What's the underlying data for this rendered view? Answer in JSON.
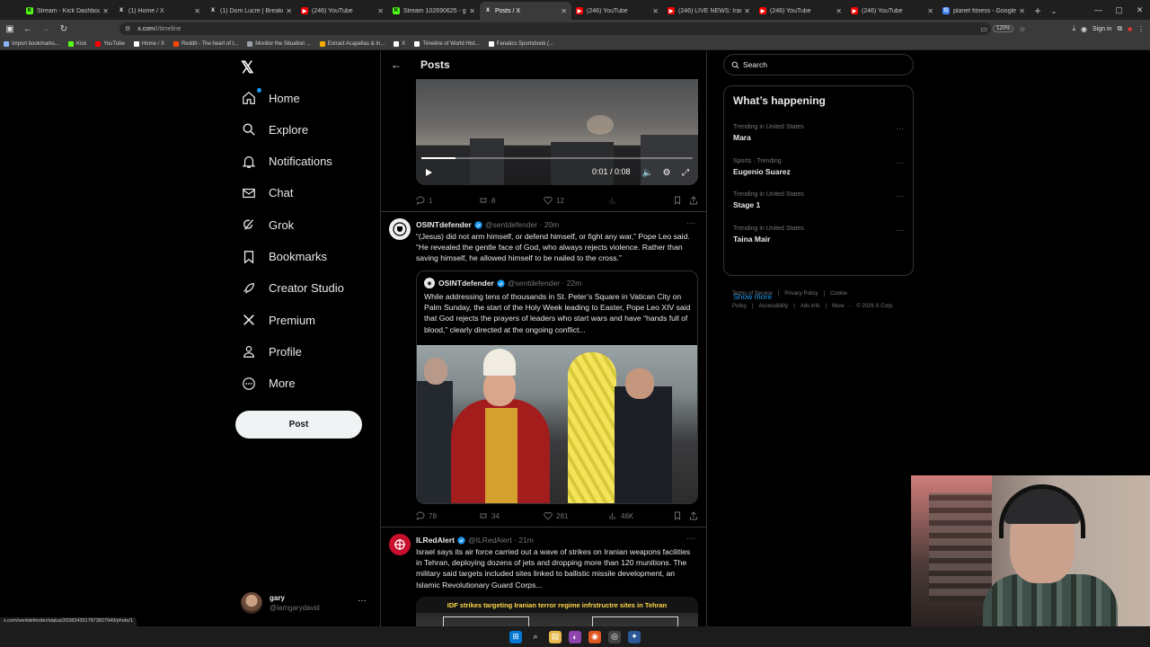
{
  "browser": {
    "tabs": [
      {
        "title": "Stream - Kick Dashboard",
        "fav_color": "#53fc18",
        "fav_glyph": "K",
        "active": false
      },
      {
        "title": "(1) Home / X",
        "fav_color": "#000000",
        "fav_glyph": "X",
        "active": false
      },
      {
        "title": "(1) Dom Lucre | Breaker of I",
        "fav_color": "#000000",
        "fav_glyph": "X",
        "active": false
      },
      {
        "title": "(246) YouTube",
        "fav_color": "#ff0000",
        "fav_glyph": "▶",
        "active": false
      },
      {
        "title": "Stream 102690625 - garyd…",
        "fav_color": "#53fc18",
        "fav_glyph": "K",
        "active": false
      },
      {
        "title": "Posts / X",
        "fav_color": "#000000",
        "fav_glyph": "X",
        "active": true
      },
      {
        "title": "(246) YouTube",
        "fav_color": "#ff0000",
        "fav_glyph": "▶",
        "active": false
      },
      {
        "title": "(246) LIVE NEWS: Iran war I…",
        "fav_color": "#ff0000",
        "fav_glyph": "▶",
        "active": false
      },
      {
        "title": "(246) YouTube",
        "fav_color": "#ff0000",
        "fav_glyph": "▶",
        "active": false
      },
      {
        "title": "(246) YouTube",
        "fav_color": "#ff0000",
        "fav_glyph": "▶",
        "active": false
      },
      {
        "title": "planet fitness - Google Sear…",
        "fav_color": "#4285f4",
        "fav_glyph": "G",
        "active": false
      }
    ],
    "url_host": "x.com",
    "url_path": "/i/timeline",
    "zoom": "120%",
    "signin_label": "Sign in",
    "bookmarks": [
      {
        "label": "Import bookmarks...",
        "color": "#8ab4f8"
      },
      {
        "label": "Kick",
        "color": "#53fc18"
      },
      {
        "label": "YouTube",
        "color": "#ff0000"
      },
      {
        "label": "Home / X",
        "color": "#ffffff"
      },
      {
        "label": "Reddit - The heart of t...",
        "color": "#ff4500"
      },
      {
        "label": "Monitor the Situation ...",
        "color": "#9aa0a6"
      },
      {
        "label": "Extract Acapellas & In...",
        "color": "#f9ab00"
      },
      {
        "label": "X",
        "color": "#ffffff"
      },
      {
        "label": "Timeline of World Hist...",
        "color": "#ffffff"
      },
      {
        "label": "Fanatics Sportsbook (...",
        "color": "#ffffff"
      }
    ],
    "status_url": "x.com/sentdefender/status/2038343517873827949/photo/1"
  },
  "leftnav": {
    "items": [
      {
        "label": "Home",
        "icon": "home-icon"
      },
      {
        "label": "Explore",
        "icon": "search-icon"
      },
      {
        "label": "Notifications",
        "icon": "bell-icon"
      },
      {
        "label": "Chat",
        "icon": "mail-icon"
      },
      {
        "label": "Grok",
        "icon": "grok-icon"
      },
      {
        "label": "Bookmarks",
        "icon": "bookmark-icon"
      },
      {
        "label": "Creator Studio",
        "icon": "rocket-icon"
      },
      {
        "label": "Premium",
        "icon": "x-logo-icon"
      },
      {
        "label": "Profile",
        "icon": "person-icon"
      },
      {
        "label": "More",
        "icon": "more-circle-icon"
      }
    ],
    "post_label": "Post",
    "account": {
      "name": "gary",
      "handle": "@iamgarydavid"
    }
  },
  "main": {
    "header_title": "Posts",
    "video": {
      "time": "0:01 / 0:08",
      "progress": 0.125
    },
    "post1_actions": {
      "replies": "1",
      "reposts": "8",
      "likes": "12",
      "views": ""
    },
    "post2": {
      "name": "OSINTdefender",
      "handle": "@sentdefender",
      "time": "· 20m",
      "text": "“(Jesus) did not arm himself, or defend himself, or fight any war,” Pope Leo said. “He revealed the gentle face of God, who always rejects violence. Rather than saving himself, he allowed himself to be nailed to the cross.”",
      "quote": {
        "name": "OSINTdefender",
        "handle": "@sentdefender",
        "time": "· 22m",
        "text": "While addressing tens of thousands in St. Peter’s Square in Vatican City on Palm Sunday, the start of the Holy Week leading to Easter, Pope Leo XIV said that God rejects the prayers of leaders who start wars and have “hands full of blood,” clearly directed at the ongoing conflict..."
      },
      "actions": {
        "replies": "78",
        "reposts": "34",
        "likes": "281",
        "views": "46K"
      }
    },
    "post3": {
      "name": "ILRedAlert",
      "handle": "@ILRedAlert",
      "time": "· 21m",
      "text": "Israel says its air force carried out a wave of strikes on Iranian weapons facilities in Tehran, deploying dozens of jets and dropping more than 120 munitions. The military said targets included sites linked to ballistic missile development, an Islamic Revolutionary Guard Corps...",
      "image_caption": "IDF strikes targeting Iranian terror regime infrstructre sites in Tehran"
    }
  },
  "right": {
    "search_placeholder": "Search",
    "trends_title": "What’s happening",
    "trends": [
      {
        "meta": "Trending in United States",
        "name": "Mara"
      },
      {
        "meta": "Sports · Trending",
        "name": "Eugenio Suarez"
      },
      {
        "meta": "Trending in United States",
        "name": "Stage 1"
      },
      {
        "meta": "Trending in United States",
        "name": "Taina Mair"
      }
    ],
    "show_more": "Show more",
    "footer": [
      "Terms of Service",
      "|",
      "Privacy Policy",
      "|",
      "Cookie Policy",
      "|",
      "Accessibility",
      "|",
      "Ads info",
      "|",
      "More ···",
      "© 2026 X Corp."
    ]
  },
  "colors": {
    "accent": "#1d9bf0",
    "background": "#000000",
    "border": "#2f3336",
    "muted": "#71767b"
  }
}
